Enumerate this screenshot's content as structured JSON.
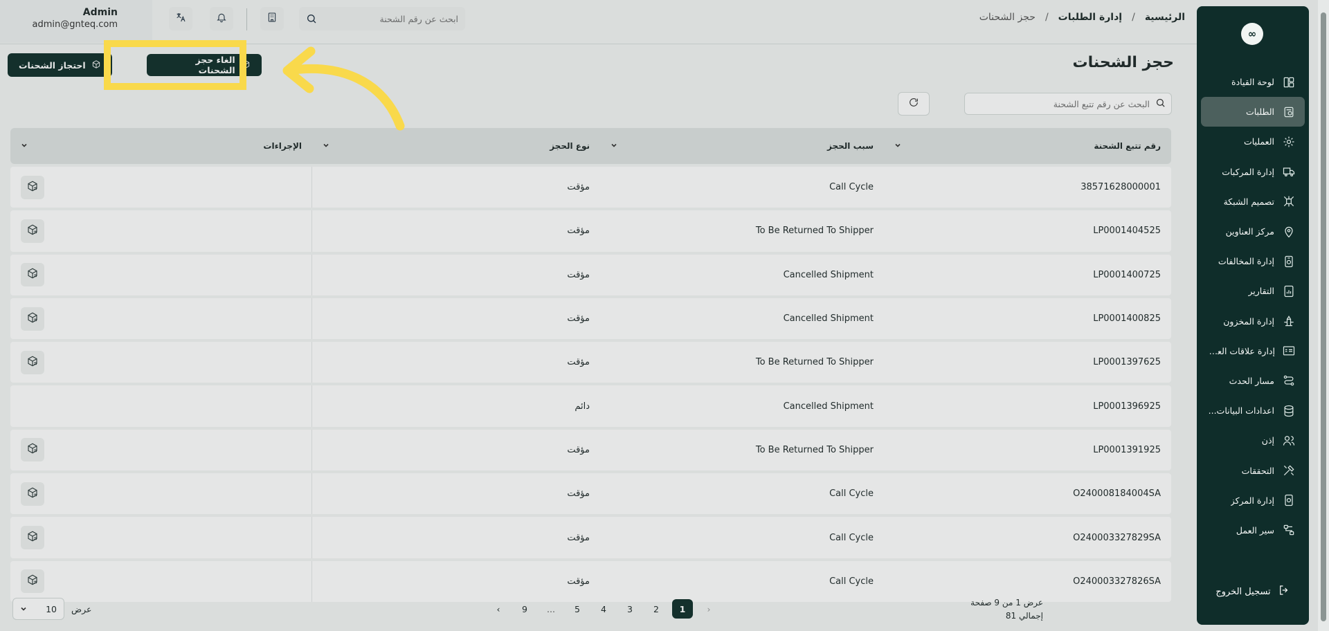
{
  "sidebar": {
    "logo": "∞",
    "items": [
      {
        "label": "لوحة القيادة",
        "icon": "dashboard-icon",
        "active": false
      },
      {
        "label": "الطلبات",
        "icon": "orders-icon",
        "active": true
      },
      {
        "label": "العمليات",
        "icon": "operations-icon",
        "active": false
      },
      {
        "label": "إدارة المركبات",
        "icon": "truck-icon",
        "active": false
      },
      {
        "label": "تصميم الشبكة",
        "icon": "network-icon",
        "active": false
      },
      {
        "label": "مركز العناوين",
        "icon": "map-pin-icon",
        "active": false
      },
      {
        "label": "إدارة المخالفات",
        "icon": "violations-icon",
        "active": false
      },
      {
        "label": "التقارير",
        "icon": "reports-icon",
        "active": false
      },
      {
        "label": "إدارة المخزون",
        "icon": "inventory-icon",
        "active": false
      },
      {
        "label": "إدارة علاقات العملاء",
        "icon": "crm-icon",
        "active": false
      },
      {
        "label": "مسار الحدث",
        "icon": "event-path-icon",
        "active": false
      },
      {
        "label": "اعدادات البيانات...",
        "icon": "database-icon",
        "active": false
      },
      {
        "label": "إذن",
        "icon": "users-icon",
        "active": false
      },
      {
        "label": "التحققات",
        "icon": "tools-icon",
        "active": false
      },
      {
        "label": "إدارة المركز",
        "icon": "hub-settings-icon",
        "active": false
      },
      {
        "label": "سير العمل",
        "icon": "workflow-icon",
        "active": false
      }
    ],
    "logout": "تسجيل الخروج"
  },
  "header": {
    "breadcrumb": {
      "home": "الرئيسية",
      "section": "إدارة الطلبات",
      "current": "حجز الشحنات",
      "sep": "/"
    },
    "search_placeholder": "ابحث عن رقم الشحنة",
    "user": {
      "name": "Admin",
      "email": "admin@gnteq.com"
    }
  },
  "page": {
    "title": "حجز الشحنات",
    "cancel_hold_button": "الغاء حجز الشحنات",
    "hold_button": "احتجاز الشحنات",
    "tracking_search_placeholder": "البحث عن رقم تتبع الشحنة"
  },
  "table": {
    "headers": {
      "tracking": "رقم تتبع الشحنة",
      "reason": "سبب الحجز",
      "type": "نوع الحجز",
      "actions": "الإجراءات"
    },
    "rows": [
      {
        "tracking": "38571628000001",
        "reason": "Call Cycle",
        "type": "مؤقت",
        "action": true
      },
      {
        "tracking": "LP0001404525",
        "reason": "To Be Returned To Shipper",
        "type": "مؤقت",
        "action": true
      },
      {
        "tracking": "LP0001400725",
        "reason": "Cancelled Shipment",
        "type": "مؤقت",
        "action": true
      },
      {
        "tracking": "LP0001400825",
        "reason": "Cancelled Shipment",
        "type": "مؤقت",
        "action": true
      },
      {
        "tracking": "LP0001397625",
        "reason": "To Be Returned To Shipper",
        "type": "مؤقت",
        "action": true
      },
      {
        "tracking": "LP0001396925",
        "reason": "Cancelled Shipment",
        "type": "دائم",
        "action": false
      },
      {
        "tracking": "LP0001391925",
        "reason": "To Be Returned To Shipper",
        "type": "مؤقت",
        "action": true
      },
      {
        "tracking": "O240008184004SA",
        "reason": "Call Cycle",
        "type": "مؤقت",
        "action": true
      },
      {
        "tracking": "O240003327829SA",
        "reason": "Call Cycle",
        "type": "مؤقت",
        "action": true
      },
      {
        "tracking": "O240003327826SA",
        "reason": "Call Cycle",
        "type": "مؤقت",
        "action": true
      }
    ]
  },
  "pagination": {
    "info": "عرض 1 من 9 صفحة",
    "total": "إجمالي 81",
    "pages": [
      "1",
      "2",
      "3",
      "4",
      "5",
      "...",
      "9"
    ],
    "current": "1",
    "prev": "‹",
    "next": "›",
    "per_page_label": "عرض",
    "per_page_value": "10"
  },
  "colors": {
    "accent": "#12302c",
    "highlight": "#f9d94b"
  }
}
